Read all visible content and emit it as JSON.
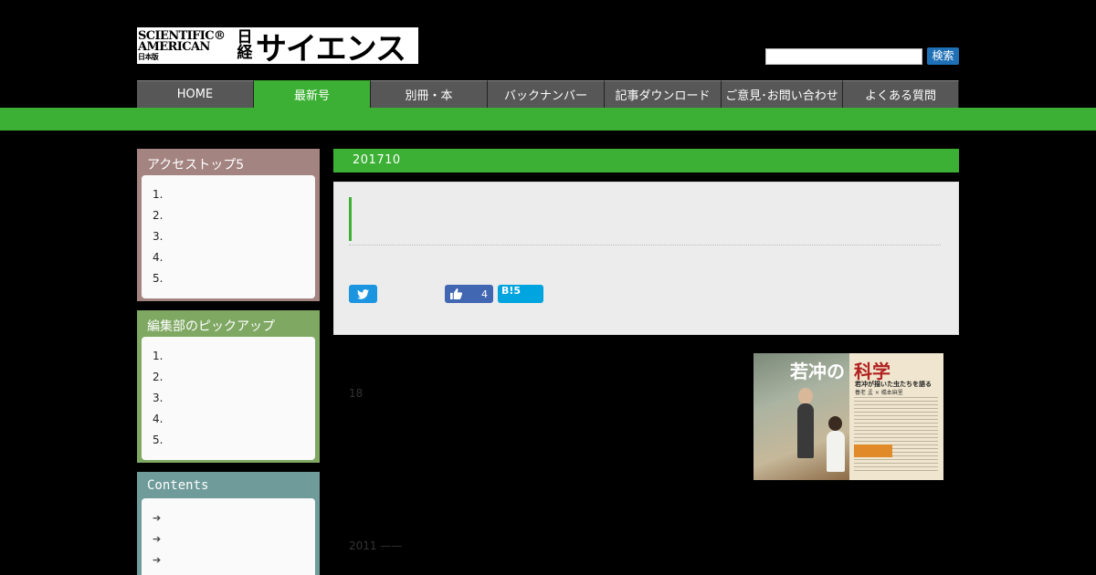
{
  "header": {
    "logo_sa_line1": "SCIENTIFIC®",
    "logo_sa_line2": "AMERICAN",
    "logo_sa_line3": "日本版",
    "logo_nikkei": "日経",
    "logo_science": "サイエンス",
    "search_placeholder": "",
    "search_button": "検索"
  },
  "nav": {
    "items": [
      {
        "label": "HOME"
      },
      {
        "label": "最新号"
      },
      {
        "label": "別冊・本"
      },
      {
        "label": "バックナンバー"
      },
      {
        "label": "記事ダウンロード"
      },
      {
        "label": "ご意見･お問い合わせ"
      },
      {
        "label": "よくある質問"
      }
    ]
  },
  "sidebar": {
    "access": {
      "title": "アクセストップ5",
      "items": [
        "1.",
        "2.",
        "3.",
        "4.",
        "5."
      ]
    },
    "pickup": {
      "title": "編集部のピックアップ",
      "items": [
        "1.",
        "2.",
        "3.",
        "4.",
        "5."
      ]
    },
    "contents": {
      "title": "Contents"
    }
  },
  "main": {
    "issue_label": "201710",
    "social": {
      "facebook_count": "4",
      "hatena_label": "B!",
      "hatena_count": "5"
    },
    "text_18": "18",
    "text_2011": "2011 ——",
    "thumbnail": {
      "title_part1": "若冲の",
      "title_part2": "科学",
      "subtitle": "若冲が描いた虫たちを語る",
      "authors": "養老 孟 × 橋本麻里"
    }
  },
  "colors": {
    "accent_green": "#3cb034",
    "nav_gray": "#575757",
    "search_blue": "#1e6fb5"
  }
}
